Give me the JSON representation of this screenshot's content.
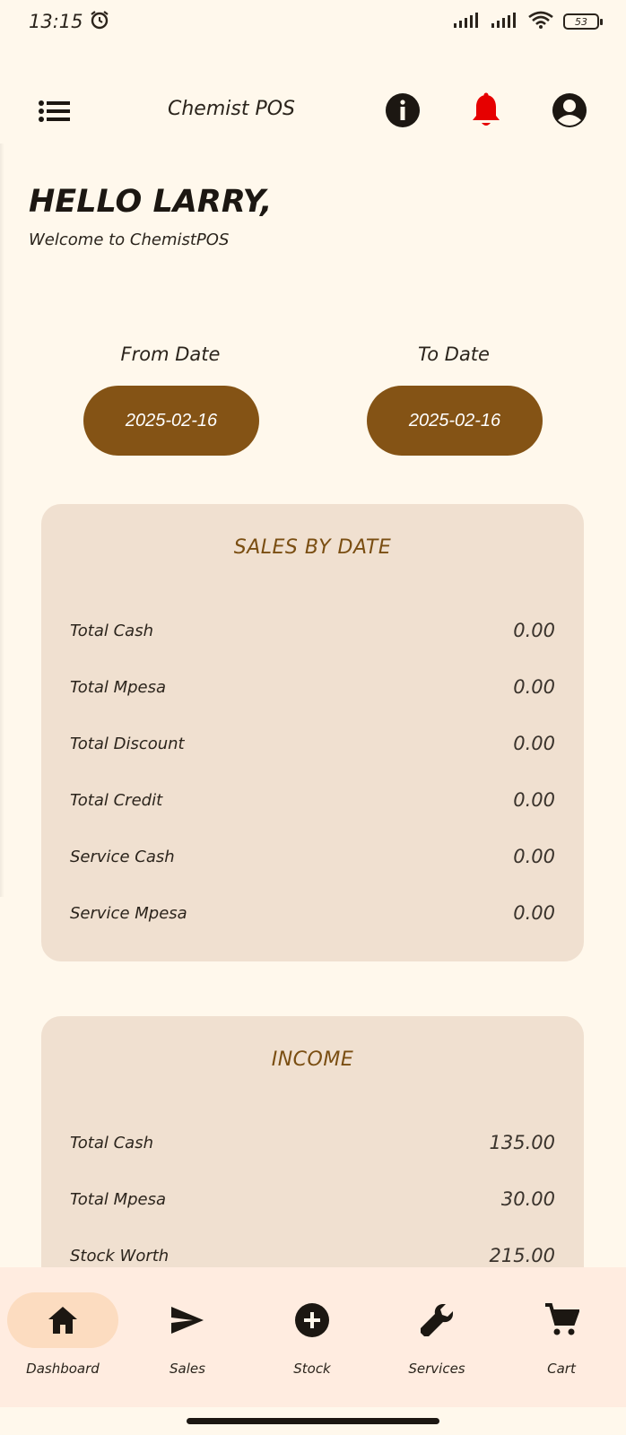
{
  "status_bar": {
    "time": "13:15",
    "battery": "53"
  },
  "app_bar": {
    "title": "Chemist POS"
  },
  "greeting": {
    "title": "HELLO LARRY,",
    "subtitle": "Welcome to ChemistPOS"
  },
  "date_range": {
    "from_label": "From Date",
    "from_value": "2025-02-16",
    "to_label": "To Date",
    "to_value": "2025-02-16"
  },
  "sales_card": {
    "title": "SALES BY DATE",
    "rows": [
      {
        "label": "Total Cash",
        "value": "0.00"
      },
      {
        "label": "Total Mpesa",
        "value": "0.00"
      },
      {
        "label": "Total Discount",
        "value": "0.00"
      },
      {
        "label": "Total Credit",
        "value": "0.00"
      },
      {
        "label": "Service Cash",
        "value": "0.00"
      },
      {
        "label": "Service Mpesa",
        "value": "0.00"
      }
    ]
  },
  "income_card": {
    "title": "INCOME",
    "rows": [
      {
        "label": "Total Cash",
        "value": "135.00"
      },
      {
        "label": "Total Mpesa",
        "value": "30.00"
      },
      {
        "label": "Stock Worth",
        "value": "215.00"
      }
    ]
  },
  "bottom_nav": {
    "items": [
      {
        "label": "Dashboard",
        "icon": "home-icon",
        "active": true
      },
      {
        "label": "Sales",
        "icon": "send-icon",
        "active": false
      },
      {
        "label": "Stock",
        "icon": "add-circle-icon",
        "active": false
      },
      {
        "label": "Services",
        "icon": "wrench-icon",
        "active": false
      },
      {
        "label": "Cart",
        "icon": "cart-icon",
        "active": false
      }
    ]
  },
  "colors": {
    "background": "#fff8ec",
    "accent_brown": "#845315",
    "card": "#f0e0d0",
    "card_title": "#7a4e12",
    "bell_red": "#e60000",
    "nav_background": "#ffece0",
    "nav_active_pill": "#fcdcc0"
  }
}
